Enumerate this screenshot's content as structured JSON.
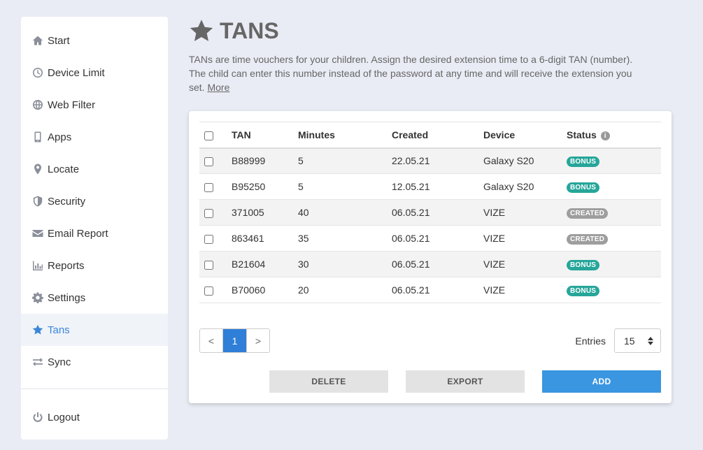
{
  "sidebar": {
    "items": [
      {
        "label": "Start",
        "icon": "home-icon"
      },
      {
        "label": "Device Limit",
        "icon": "clock-icon"
      },
      {
        "label": "Web Filter",
        "icon": "globe-icon"
      },
      {
        "label": "Apps",
        "icon": "mobile-icon"
      },
      {
        "label": "Locate",
        "icon": "map-marker-icon"
      },
      {
        "label": "Security",
        "icon": "shield-icon"
      },
      {
        "label": "Email Report",
        "icon": "envelope-icon"
      },
      {
        "label": "Reports",
        "icon": "bar-chart-icon"
      },
      {
        "label": "Settings",
        "icon": "gear-icon"
      },
      {
        "label": "Tans",
        "icon": "star-icon",
        "active": true
      },
      {
        "label": "Sync",
        "icon": "sync-arrows-icon"
      }
    ],
    "logout": {
      "label": "Logout",
      "icon": "power-icon"
    }
  },
  "header": {
    "title": "TANS",
    "icon": "star-icon"
  },
  "description": {
    "text": "TANs are time vouchers for your children. Assign the desired extension time to a 6-digit TAN (number). The child can enter this number instead of the password at any time and will receive the extension you set.",
    "more_link": "More"
  },
  "table": {
    "columns": {
      "tan": "TAN",
      "minutes": "Minutes",
      "created": "Created",
      "device": "Device",
      "status": "Status"
    },
    "rows": [
      {
        "tan": "B88999",
        "minutes": "5",
        "created": "22.05.21",
        "device": "Galaxy S20",
        "status": "BONUS"
      },
      {
        "tan": "B95250",
        "minutes": "5",
        "created": "12.05.21",
        "device": "Galaxy S20",
        "status": "BONUS"
      },
      {
        "tan": "371005",
        "minutes": "40",
        "created": "06.05.21",
        "device": "VIZE",
        "status": "CREATED"
      },
      {
        "tan": "863461",
        "minutes": "35",
        "created": "06.05.21",
        "device": "VIZE",
        "status": "CREATED"
      },
      {
        "tan": "B21604",
        "minutes": "30",
        "created": "06.05.21",
        "device": "VIZE",
        "status": "BONUS"
      },
      {
        "tan": "B70060",
        "minutes": "20",
        "created": "06.05.21",
        "device": "VIZE",
        "status": "BONUS"
      }
    ]
  },
  "status_colors": {
    "BONUS": "#26a69a",
    "CREATED": "#9e9e9e"
  },
  "pagination": {
    "prev": "<",
    "current": "1",
    "next": ">"
  },
  "entries": {
    "label": "Entries",
    "value": "15"
  },
  "actions": {
    "delete": "DELETE",
    "export": "EXPORT",
    "add": "ADD"
  },
  "colors": {
    "accent": "#3a86d8",
    "add_button": "#3a96e0",
    "background": "#e9ecf4"
  }
}
